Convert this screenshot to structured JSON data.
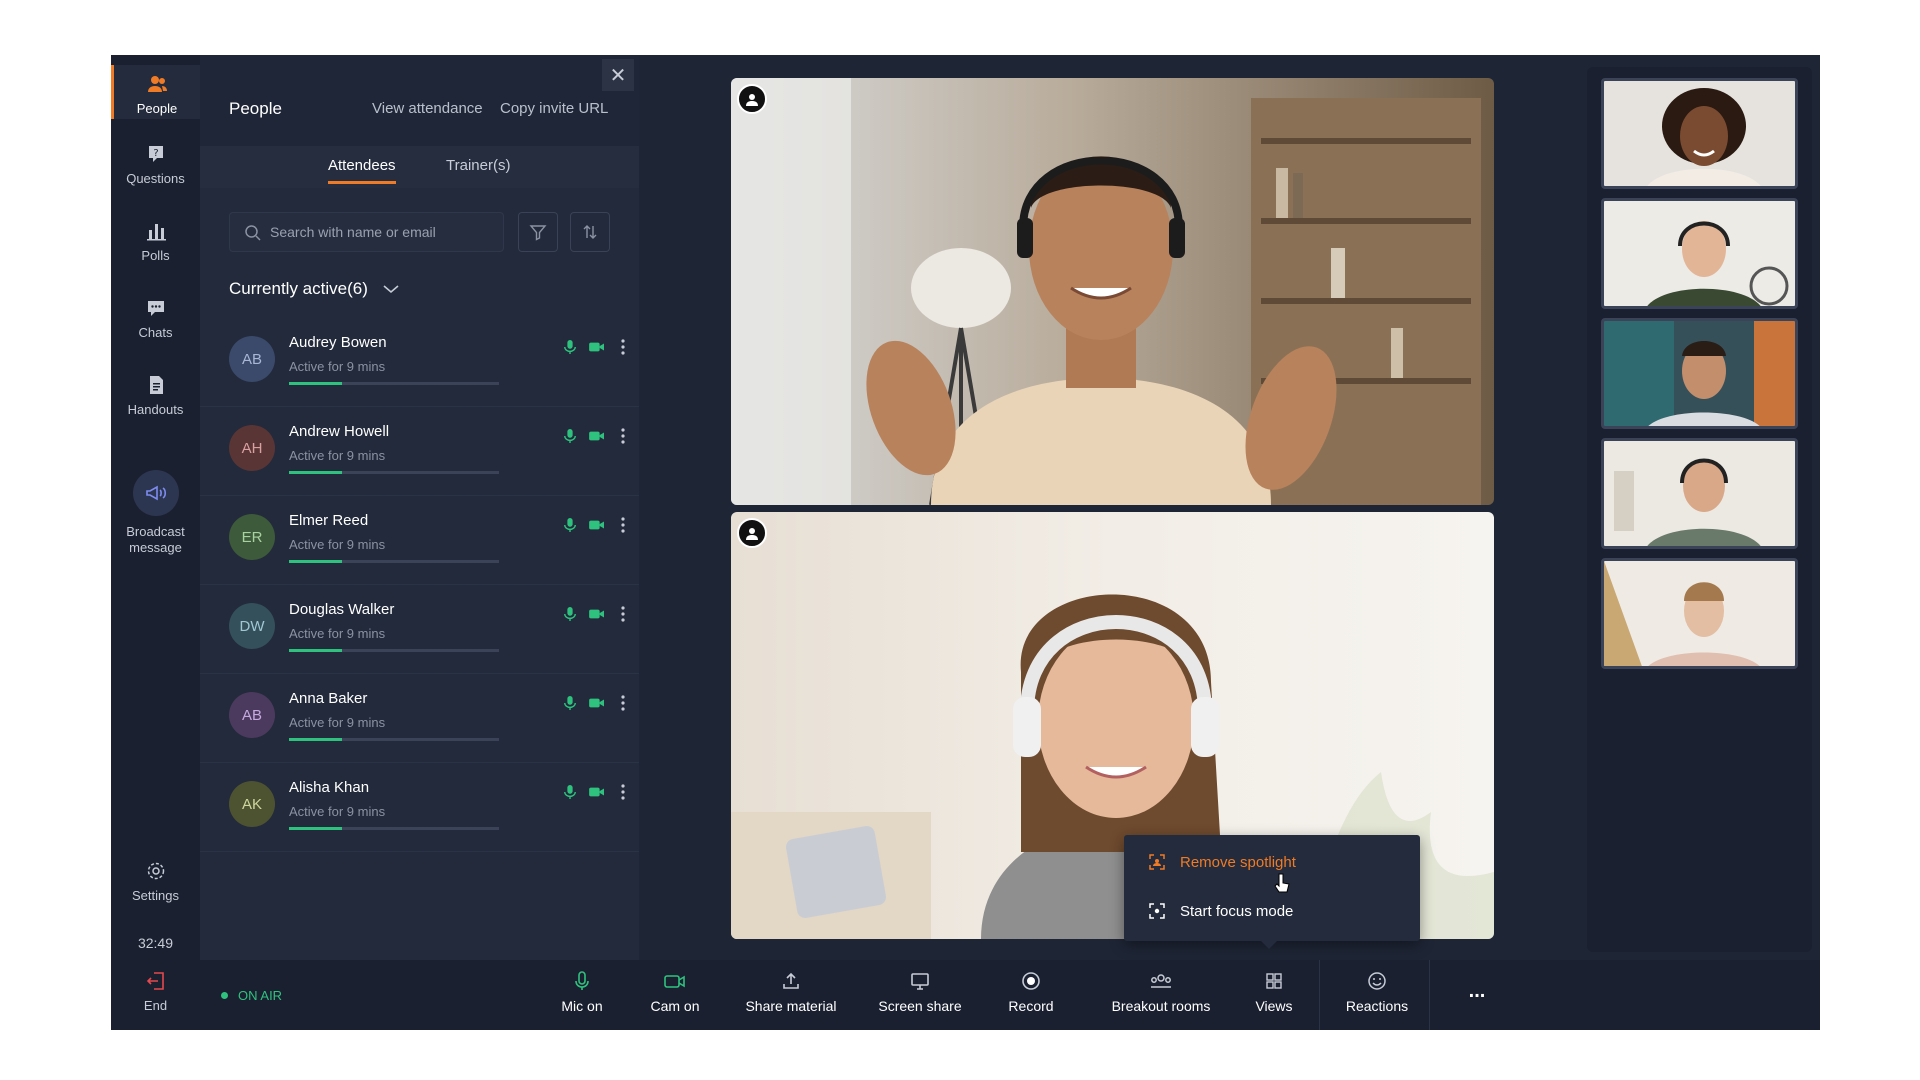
{
  "rail": {
    "people": "People",
    "questions": "Questions",
    "polls": "Polls",
    "chats": "Chats",
    "handouts": "Handouts",
    "broadcast": "Broadcast message",
    "settings": "Settings",
    "timer": "32:49",
    "end": "End"
  },
  "panel": {
    "title": "People",
    "view_attendance": "View attendance",
    "copy_invite": "Copy invite URL",
    "tabs": [
      "Attendees",
      "Trainer(s)"
    ],
    "search_placeholder": "Search with name or email",
    "section": "Currently active(6)",
    "attendees": [
      {
        "initials": "AB",
        "name": "Audrey Bowen",
        "status": "Active for 9 mins",
        "progress": 0.25,
        "color": "#3b4a6b",
        "text": "#a9b6d6"
      },
      {
        "initials": "AH",
        "name": "Andrew Howell",
        "status": "Active for 9 mins",
        "progress": 0.25,
        "color": "#5a3535",
        "text": "#d9a0a0"
      },
      {
        "initials": "ER",
        "name": "Elmer Reed",
        "status": "Active for 9 mins",
        "progress": 0.25,
        "color": "#3d5a3a",
        "text": "#a8d1a0"
      },
      {
        "initials": "DW",
        "name": "Douglas Walker",
        "status": "Active for 9 mins",
        "progress": 0.25,
        "color": "#34505a",
        "text": "#9fc8d4"
      },
      {
        "initials": "AB",
        "name": "Anna Baker",
        "status": "Active for 9 mins",
        "progress": 0.25,
        "color": "#4b3a5e",
        "text": "#c5a9df"
      },
      {
        "initials": "AK",
        "name": "Alisha Khan",
        "status": "Active for 9 mins",
        "progress": 0.25,
        "color": "#4d5330",
        "text": "#cfd59c"
      }
    ]
  },
  "menu": {
    "remove_spotlight": "Remove spotlight",
    "start_focus": "Start focus mode"
  },
  "bottom": {
    "on_air": "ON AIR",
    "tools": [
      "Mic on",
      "Cam on",
      "Share material",
      "Screen share",
      "Record",
      "Breakout rooms",
      "Views",
      "Reactions"
    ],
    "more": "..."
  },
  "colors": {
    "accent": "#f07b26",
    "active_green": "#2ec27e"
  }
}
